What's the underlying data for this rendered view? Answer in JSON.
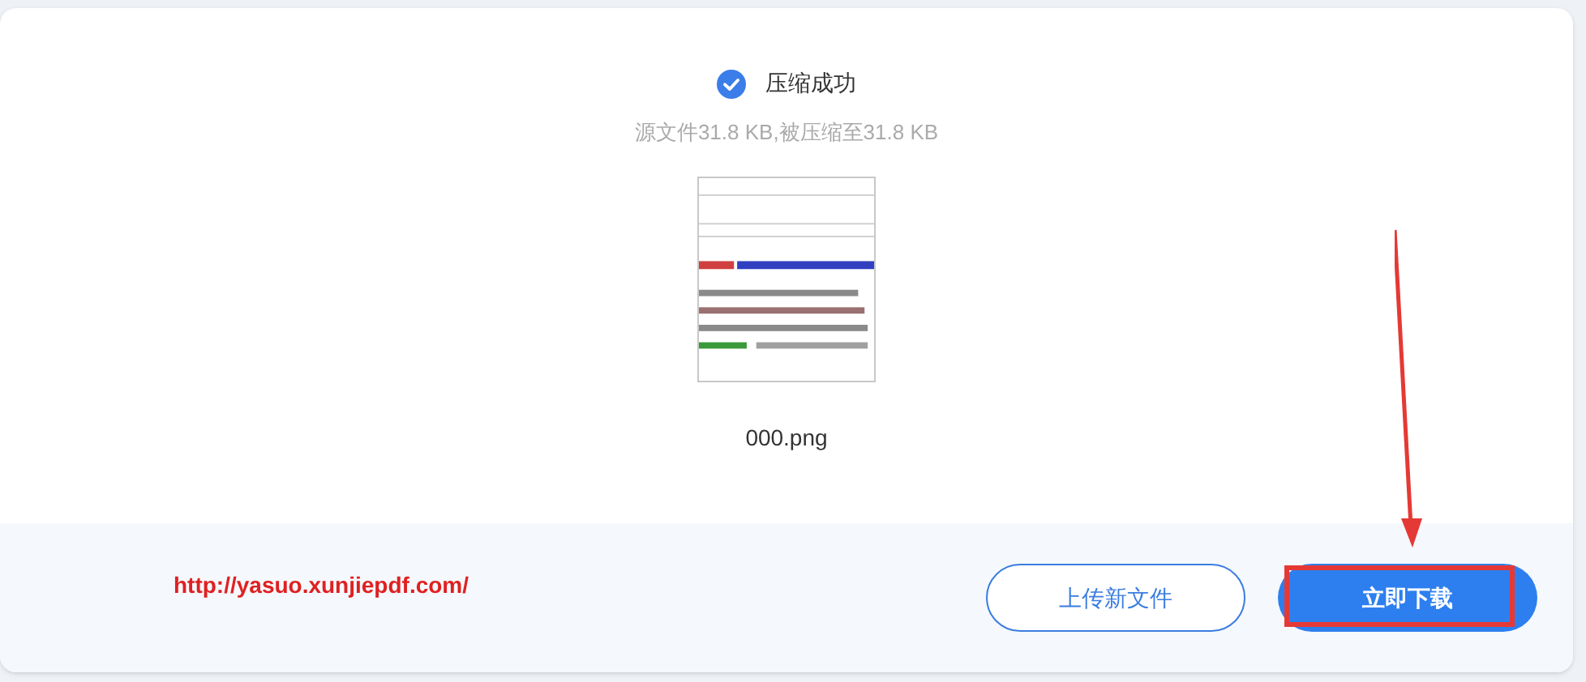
{
  "result": {
    "checked": true,
    "title": "压缩成功",
    "summary": "源文件31.8 KB,被压缩至31.8 KB",
    "file_name": "000.png"
  },
  "footer": {
    "url": "http://yasuo.xunjiepdf.com/",
    "buttons": [
      {
        "label": "上传新文件",
        "kind": "outline"
      },
      {
        "label": "立即下载",
        "kind": "primary",
        "highlighted": true
      }
    ]
  }
}
